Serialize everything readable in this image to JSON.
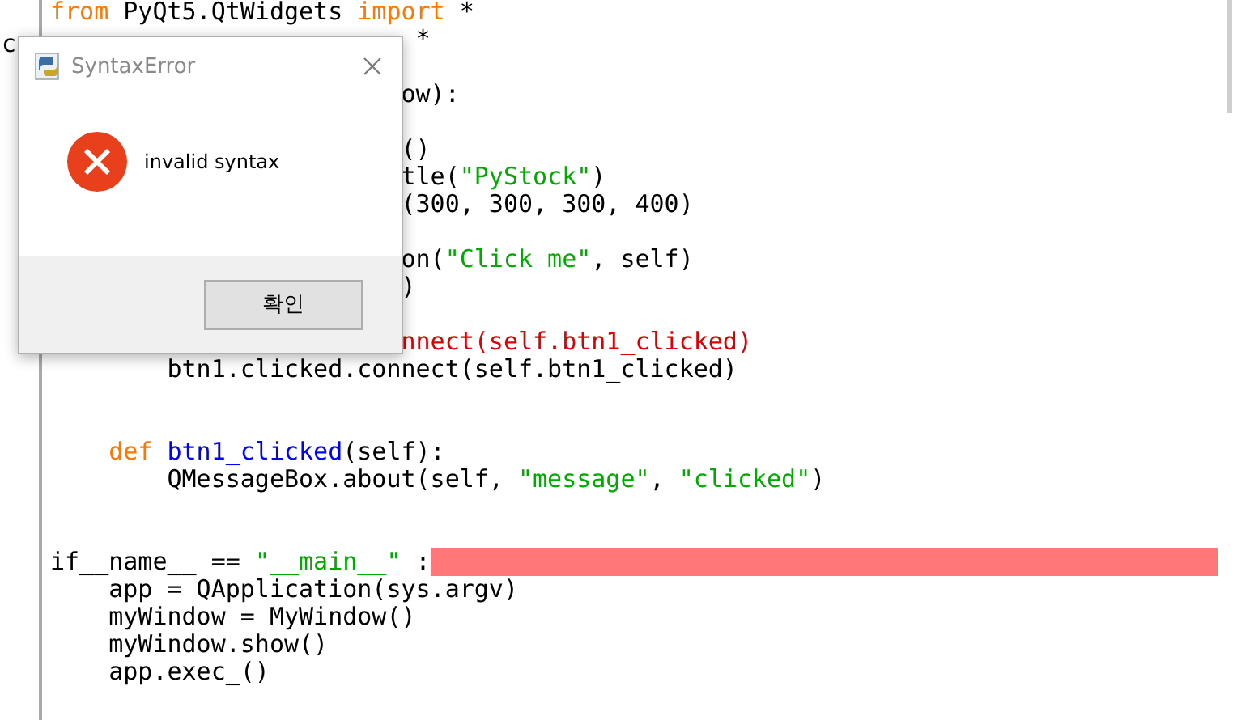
{
  "margin_text": "c",
  "editor": {
    "lines": [
      {
        "kind": "code",
        "segments": [
          {
            "text": "from",
            "kind": "keyword"
          },
          {
            "text": " PyQt5.QtWidgets ",
            "kind": "plain"
          },
          {
            "text": "import",
            "kind": "keyword"
          },
          {
            "text": " *",
            "kind": "plain"
          }
        ]
      },
      {
        "kind": "covered",
        "segments": [
          {
            "text": " *",
            "kind": "plain"
          }
        ]
      },
      {
        "kind": "blank"
      },
      {
        "kind": "covered",
        "segments": [
          {
            "text": "ow):",
            "kind": "plain"
          }
        ]
      },
      {
        "kind": "blank"
      },
      {
        "kind": "covered",
        "segments": [
          {
            "text": "()",
            "kind": "plain"
          }
        ]
      },
      {
        "kind": "covered",
        "segments": [
          {
            "text": "tle(",
            "kind": "plain"
          },
          {
            "text": "\"PyStock\"",
            "kind": "string"
          },
          {
            "text": ")",
            "kind": "plain"
          }
        ]
      },
      {
        "kind": "covered",
        "segments": [
          {
            "text": "(300, 300, 300, 400)",
            "kind": "plain"
          }
        ]
      },
      {
        "kind": "blank"
      },
      {
        "kind": "covered",
        "segments": [
          {
            "text": "on(",
            "kind": "plain"
          },
          {
            "text": "\"Click me\"",
            "kind": "string"
          },
          {
            "text": ", self)",
            "kind": "plain"
          }
        ]
      },
      {
        "kind": "covered",
        "segments": [
          {
            "text": ")",
            "kind": "plain"
          }
        ]
      },
      {
        "kind": "blank"
      },
      {
        "kind": "covered",
        "segments": [
          {
            "text": "nnect(self.btn1_clicked)",
            "kind": "error"
          }
        ]
      },
      {
        "kind": "code",
        "segments": [
          {
            "text": "        btn1.clicked.connect(self.btn1_clicked)",
            "kind": "plain"
          }
        ]
      },
      {
        "kind": "blank"
      },
      {
        "kind": "blank"
      },
      {
        "kind": "code",
        "segments": [
          {
            "text": "    def",
            "kind": "keyword"
          },
          {
            "text": " btn1_clicked",
            "kind": "definition"
          },
          {
            "text": "(self):",
            "kind": "plain"
          }
        ]
      },
      {
        "kind": "code",
        "segments": [
          {
            "text": "        QMessageBox.about(self, ",
            "kind": "plain"
          },
          {
            "text": "\"message\"",
            "kind": "string"
          },
          {
            "text": ", ",
            "kind": "plain"
          },
          {
            "text": "\"clicked\"",
            "kind": "string"
          },
          {
            "text": ")",
            "kind": "plain"
          }
        ]
      },
      {
        "kind": "blank"
      },
      {
        "kind": "blank"
      },
      {
        "kind": "code",
        "error_line": true,
        "segments": [
          {
            "text": "if__name__ == ",
            "kind": "plain"
          },
          {
            "text": "\"__main__\"",
            "kind": "string"
          },
          {
            "text": " :",
            "kind": "plain"
          }
        ]
      },
      {
        "kind": "code",
        "segments": [
          {
            "text": "    app = QApplication(sys.argv)",
            "kind": "plain"
          }
        ]
      },
      {
        "kind": "code",
        "segments": [
          {
            "text": "    myWindow = MyWindow()",
            "kind": "plain"
          }
        ]
      },
      {
        "kind": "code",
        "segments": [
          {
            "text": "    myWindow.show()",
            "kind": "plain"
          }
        ]
      },
      {
        "kind": "code",
        "segments": [
          {
            "text": "    app.exec_()",
            "kind": "plain"
          }
        ]
      }
    ]
  },
  "dialog": {
    "title": "SyntaxError",
    "message": "invalid syntax",
    "button": "확인"
  }
}
